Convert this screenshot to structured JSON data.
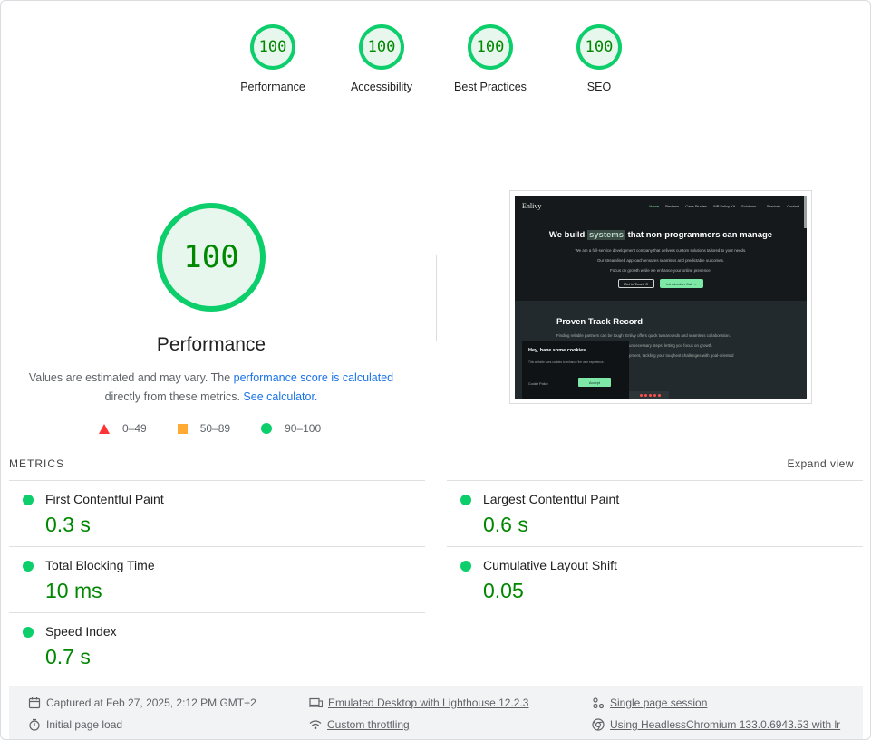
{
  "gauges": [
    {
      "score": "100",
      "label": "Performance"
    },
    {
      "score": "100",
      "label": "Accessibility"
    },
    {
      "score": "100",
      "label": "Best Practices"
    },
    {
      "score": "100",
      "label": "SEO"
    }
  ],
  "performance": {
    "score": "100",
    "title": "Performance",
    "desc_prefix": "Values are estimated and may vary. The ",
    "desc_link1": "performance score is calculated",
    "desc_middle": "directly from these metrics. ",
    "desc_link2": "See calculator."
  },
  "legend": {
    "fail": "0–49",
    "average": "50–89",
    "pass": "90–100",
    "colors": {
      "fail": "#ff3333",
      "average": "#ffaa33",
      "pass": "#0cce6b"
    }
  },
  "screenshot": {
    "logo": "Enlivy",
    "nav": [
      "Home",
      "Reviews",
      "Case Studies",
      "WP Enlivy Kit",
      "Solutions ⌄",
      "Services",
      "Contact"
    ],
    "headline_pre": "We build ",
    "headline_word": "systems",
    "headline_post": " that non-programmers can manage",
    "para1": "We are a full-service development company that delivers custom solutions tailored to your needs.",
    "para2": "Our streamlined approach ensures seamless and predictable outcomes.",
    "para3": "Focus on growth while we enhance your online presence.",
    "btn1": "Get in Touch ⊙",
    "btn2": "Introduction Call →",
    "section_title": "Proven Track Record",
    "section_line1": "Finding reliable partners can be tough. Enlivy offers quick turnarounds and seamless collaboration.",
    "section_line2": "unnecessary steps, letting you focus on growth.",
    "section_line3": "pment, tackling your toughest challenges with goal-oriented",
    "cookie_title": "Hey, have some cookies",
    "cookie_text": "This website uses cookies to enhance the user experience.",
    "cookie_policy": "Cookie Policy",
    "cookie_accept": "Accept"
  },
  "metrics": {
    "label": "METRICS",
    "expand": "Expand view",
    "items": [
      {
        "title": "First Contentful Paint",
        "value": "0.3 s"
      },
      {
        "title": "Largest Contentful Paint",
        "value": "0.6 s"
      },
      {
        "title": "Total Blocking Time",
        "value": "10 ms"
      },
      {
        "title": "Cumulative Layout Shift",
        "value": "0.05"
      },
      {
        "title": "Speed Index",
        "value": "0.7 s"
      }
    ]
  },
  "footer": {
    "captured": "Captured at Feb 27, 2025, 2:12 PM GMT+2",
    "initial_load": "Initial page load",
    "emulated": "Emulated Desktop with Lighthouse 12.2.3",
    "throttling": "Custom throttling",
    "session": "Single page session",
    "browser": "Using HeadlessChromium 133.0.6943.53 with lr"
  },
  "colors": {
    "pass": "#0cce6b",
    "pass_text": "#008800",
    "link": "#1a73e8"
  }
}
